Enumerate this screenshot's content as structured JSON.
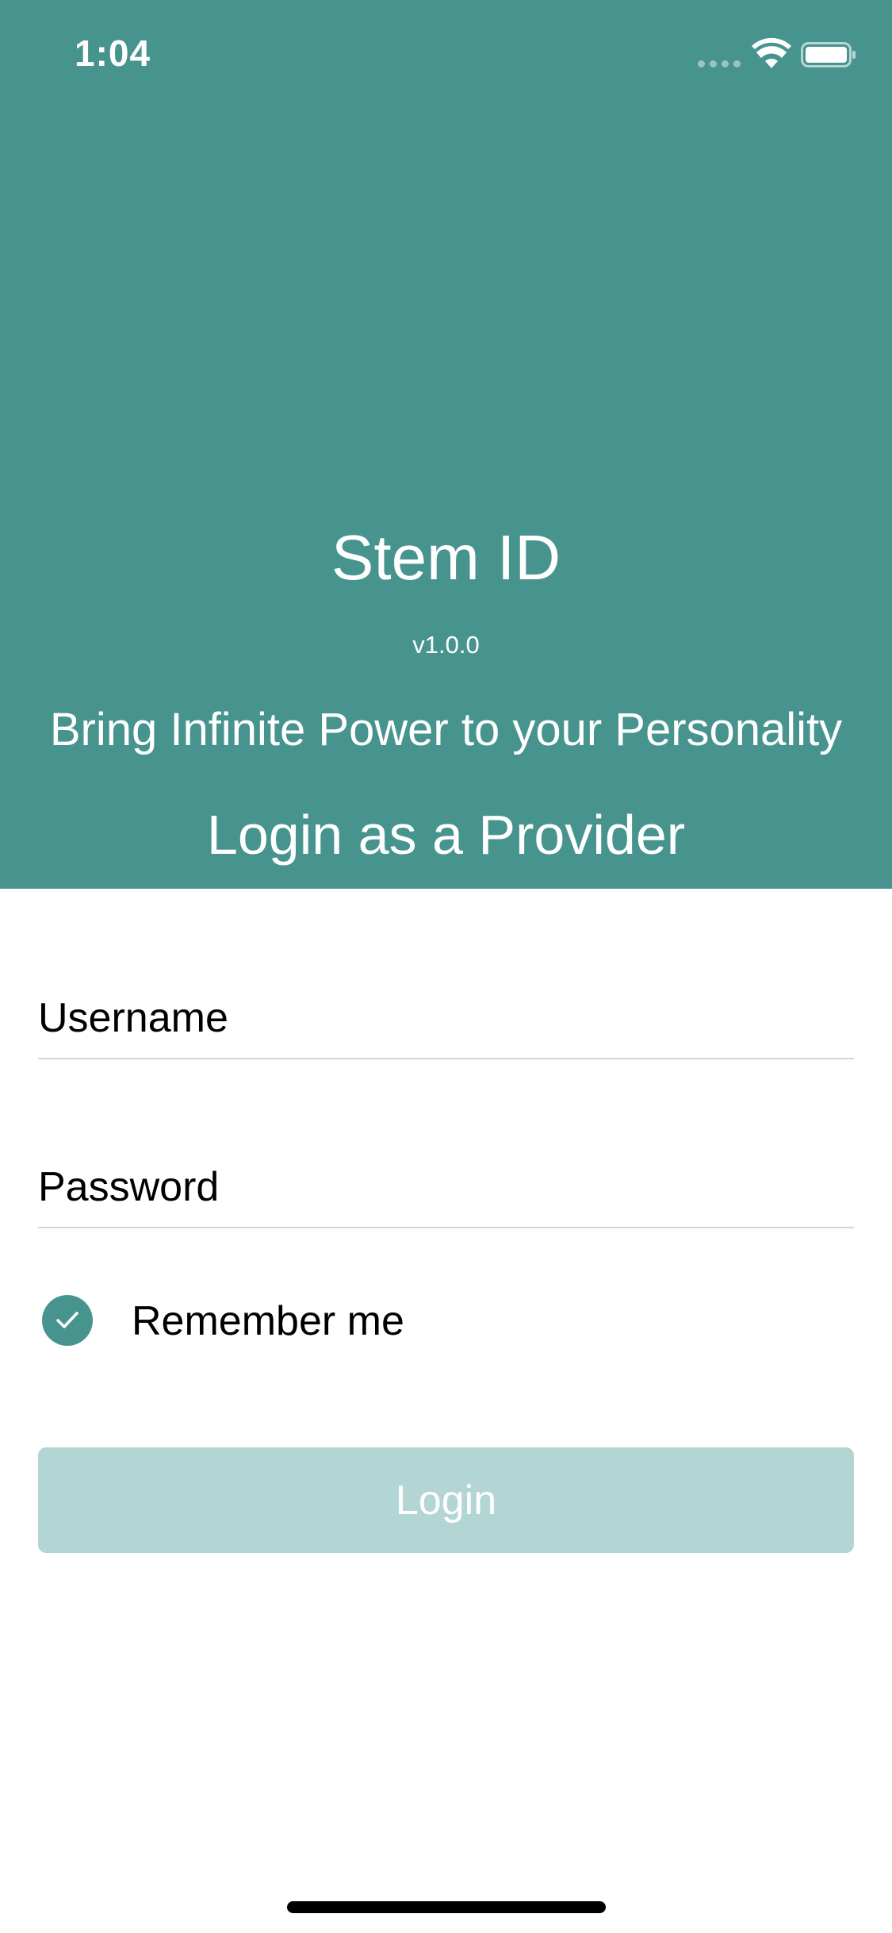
{
  "status_bar": {
    "time": "1:04",
    "signal_icon": "cellular-signal-dots",
    "wifi_icon": "wifi-icon",
    "battery_icon": "battery-icon"
  },
  "header": {
    "background_color": "#47948f",
    "app_title": "Stem ID",
    "version": "v1.0.0",
    "tagline": "Bring Infinite Power to your Personality",
    "login_heading": "Login as a Provider"
  },
  "form": {
    "username": {
      "placeholder": "Username",
      "value": ""
    },
    "password": {
      "placeholder": "Password",
      "value": ""
    },
    "remember_me": {
      "label": "Remember me",
      "checked": true
    },
    "login_button": {
      "label": "Login",
      "color": "#b3d5d4"
    }
  }
}
